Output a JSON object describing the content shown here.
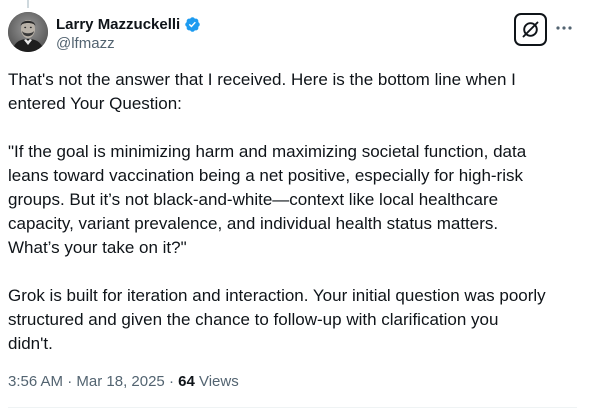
{
  "author": {
    "display_name": "Larry Mazzuckelli",
    "handle": "@lfmazz",
    "verified": true,
    "verified_color": "#1d9bf0",
    "avatar_icon": "portrait-avatar"
  },
  "actions": {
    "grok_icon": "grok-icon",
    "more_icon": "more-icon"
  },
  "tweet": {
    "paragraphs": [
      "That's not the answer that I received. Here is the bottom line when I\nentered Your Question:",
      "\"If the goal is minimizing harm and maximizing societal function, data\nleans toward vaccination being a net positive, especially for high-risk\ngroups. But it’s not black-and-white—context like local healthcare\ncapacity, variant prevalence, and individual health status matters.\nWhat’s your take on it?\"",
      "Grok is built for iteration and interaction. Your initial question was poorly\nstructured and given the chance to follow-up with clarification you\ndidn't."
    ]
  },
  "meta": {
    "time": "3:56 AM",
    "separator": " · ",
    "date": "Mar 18, 2025",
    "views_count": "64",
    "views_label": " Views"
  },
  "colors": {
    "text": "#0f1419",
    "secondary": "#536471",
    "accent": "#1d9bf0"
  }
}
